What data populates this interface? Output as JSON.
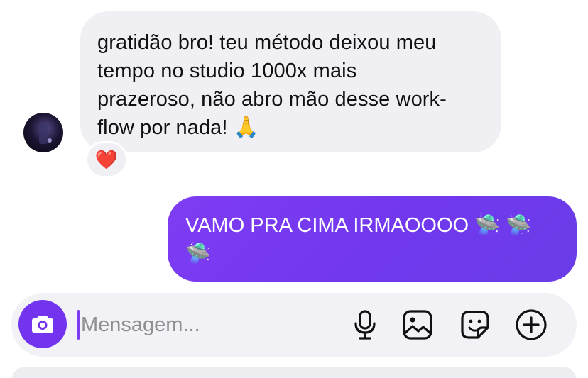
{
  "incoming_message": {
    "lines": [
      "gratidão bro! teu método deixou meu",
      "tempo no studio 1000x mais",
      "prazeroso, não abro mão desse work-",
      "flow por nada! 🙏"
    ],
    "reaction": "❤️"
  },
  "outgoing_message": {
    "lines": [
      "VAMO PRA CIMA IRMAOOOO 🛸 🛸",
      "🛸"
    ]
  },
  "composer": {
    "placeholder": "Mensagem...",
    "value": "",
    "icons": [
      "camera-icon",
      "microphone-icon",
      "gallery-icon",
      "sticker-icon",
      "plus-icon"
    ]
  },
  "colors": {
    "accent": "#7234ef",
    "outgoing_bubble": "#7138ee",
    "incoming_bubble": "#efeff4",
    "composer_bg": "#f2f2f6"
  }
}
